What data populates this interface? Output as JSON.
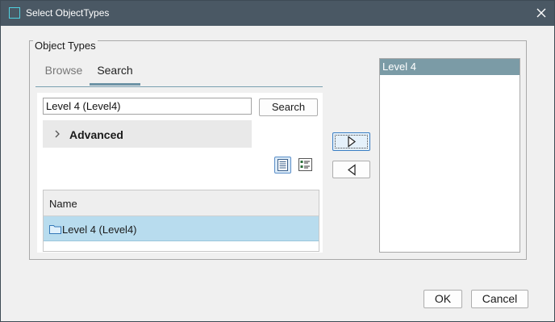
{
  "window": {
    "title": "Select ObjectTypes",
    "close_icon": "close-icon",
    "app_icon": "window-icon"
  },
  "group": {
    "legend": "Object Types"
  },
  "tabs": [
    {
      "label": "Browse",
      "active": false
    },
    {
      "label": "Search",
      "active": true
    }
  ],
  "search": {
    "value": "Level 4 (Level4)",
    "button_label": "Search"
  },
  "advanced": {
    "label": "Advanced",
    "icon": "chevron-right-icon",
    "expanded": false
  },
  "view_toggles": [
    {
      "icon": "list-view-icon",
      "active": true
    },
    {
      "icon": "detail-view-icon",
      "active": false
    }
  ],
  "results": {
    "columns": [
      "Name"
    ],
    "rows": [
      {
        "name": "Level 4 (Level4)",
        "icon": "folder-icon",
        "selected": true
      }
    ]
  },
  "transfer": {
    "add_icon": "arrow-right-icon",
    "remove_icon": "arrow-left-icon"
  },
  "selected": {
    "items": [
      "Level 4"
    ]
  },
  "footer": {
    "ok_label": "OK",
    "cancel_label": "Cancel"
  },
  "colors": {
    "titlebar": "#4a5864",
    "selection_row": "#b8dcee",
    "selected_item": "#7b9ba6",
    "tab_accent": "#6d93a5"
  }
}
